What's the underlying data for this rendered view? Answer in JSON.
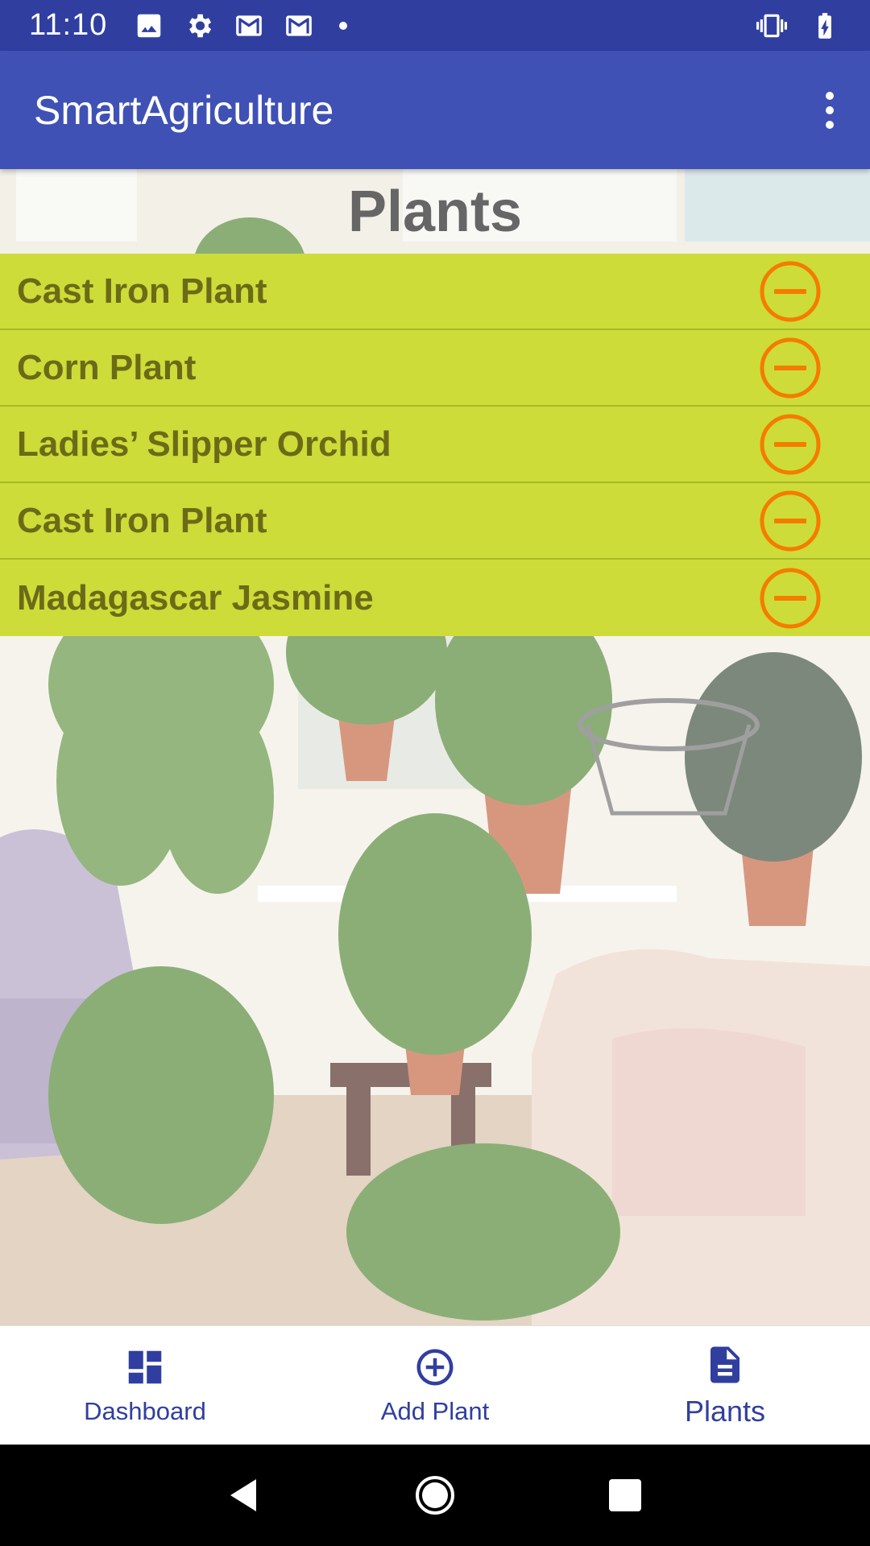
{
  "status_bar": {
    "time": "11:10",
    "left_icons": [
      "image-icon",
      "settings-gear-icon",
      "gmail-icon",
      "gmail-icon",
      "notification-dot-icon"
    ],
    "right_icons": [
      "vibrate-icon",
      "battery-icon"
    ]
  },
  "app_bar": {
    "title": "SmartAgriculture",
    "overflow_icon": "more-vert-icon"
  },
  "page": {
    "heading": "Plants"
  },
  "plants": [
    {
      "name": "Cast Iron Plant"
    },
    {
      "name": "Corn Plant"
    },
    {
      "name": "Ladies’ Slipper Orchid"
    },
    {
      "name": "Cast Iron Plant"
    },
    {
      "name": "Madagascar Jasmine"
    }
  ],
  "bottom_nav": {
    "items": [
      {
        "label": "Dashboard",
        "icon": "dashboard-icon",
        "active": false
      },
      {
        "label": "Add Plant",
        "icon": "add-circle-icon",
        "active": false
      },
      {
        "label": "Plants",
        "icon": "document-icon",
        "active": true
      }
    ]
  },
  "colors": {
    "status_bar": "#303f9f",
    "app_bar": "#3f51b5",
    "list_row": "#cddc39",
    "remove_icon": "#f57c00",
    "nav_icon": "#303f9f"
  }
}
